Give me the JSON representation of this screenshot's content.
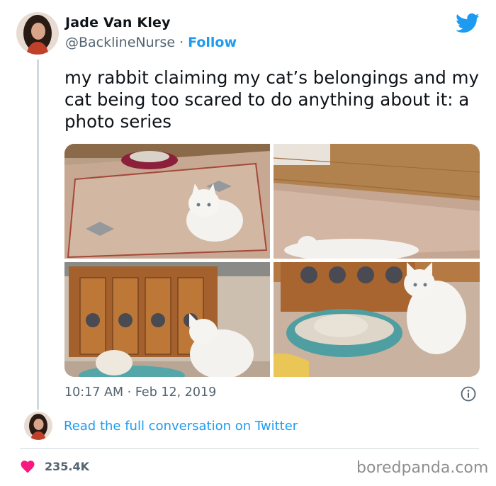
{
  "author": {
    "display_name": "Jade Van Kley",
    "handle": "@BacklineNurse",
    "separator": "·",
    "follow_label": "Follow"
  },
  "tweet": {
    "text": "my rabbit claiming my cat’s belongings and my cat being too scared to do anything about it: a photo series",
    "time": "10:17 AM",
    "date_separator": "·",
    "date": "Feb 12, 2019"
  },
  "read_conversation_label": "Read the full conversation on Twitter",
  "likes": {
    "count": "235.4K",
    "icon": "heart-icon"
  },
  "watermark": "boredpanda.com",
  "colors": {
    "twitter_blue": "#1d9bf0",
    "text_primary": "#0f1419",
    "text_secondary": "#536471",
    "heart": "#f91880",
    "divider": "#cfd9de"
  }
}
